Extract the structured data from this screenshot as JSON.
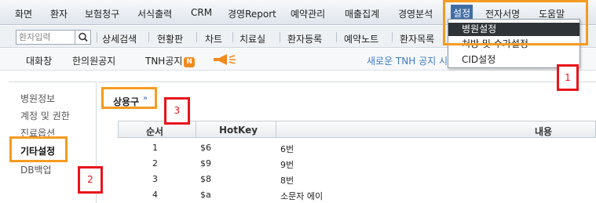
{
  "menubar": {
    "items": [
      "화면",
      "환자",
      "보험청구",
      "서식출력",
      "CRM",
      "경영Report",
      "예약관리",
      "매출집계",
      "경영분석",
      "설정",
      "전자서명",
      "도움말"
    ],
    "selected": "설정"
  },
  "toolbar": {
    "search_placeholder": "환자입력",
    "items": [
      "상세검색",
      "현황판",
      "차트",
      "치료실",
      "환자등록",
      "예약노트",
      "환자목록"
    ]
  },
  "row3": {
    "items": [
      "대화창",
      "한의원공지",
      "TNH공지"
    ],
    "badge": "N",
    "notice": "새로운 TNH 공지 시"
  },
  "settings_dropdown": {
    "items": [
      "병원설정",
      "처방 및 수가설정",
      "CID설정"
    ],
    "highlighted": "병원설정"
  },
  "left_nav": {
    "items": [
      "병원정보",
      "계정 및 권한",
      "진료옵션",
      "기타설정",
      "DB백업"
    ],
    "active": "기타설정"
  },
  "main": {
    "section_title": "상용구",
    "table": {
      "headers": [
        "순서",
        "HotKey",
        "내용"
      ],
      "rows": [
        [
          "1",
          "$6",
          "6번"
        ],
        [
          "2",
          "$9",
          "9번"
        ],
        [
          "3",
          "$8",
          "8번"
        ],
        [
          "4",
          "$a",
          "소문자 에이"
        ]
      ]
    }
  },
  "annotations": {
    "labels": [
      "1",
      "2",
      "3"
    ]
  },
  "colors": {
    "annotation_orange": "#f59b21",
    "annotation_red": "#e8151b",
    "menu_selected": "#3f6ea6",
    "dropdown_highlight": "#2f3438",
    "notice_text": "#3d7cc0",
    "badge": "#f08a1c"
  },
  "icons": {
    "search": "search-icon",
    "megaphone": "megaphone-icon",
    "chevron": "double-chevron-down-icon"
  }
}
